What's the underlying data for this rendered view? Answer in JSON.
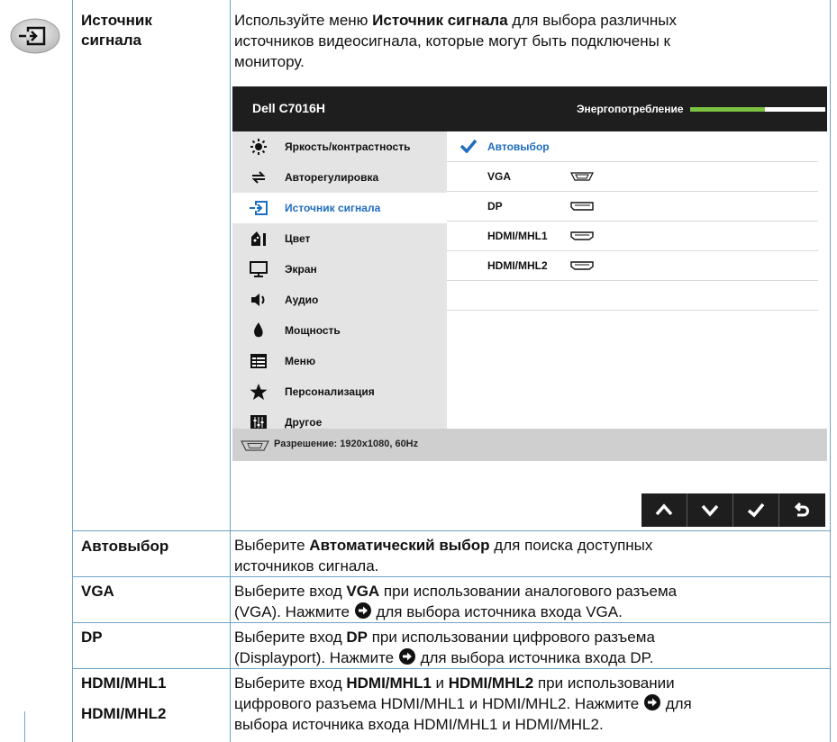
{
  "header_row": {
    "term_line1": "Источник",
    "term_line2": "сигнала",
    "desc_line1_pre": "Используйте меню ",
    "desc_line1_bold": "Источник сигнала",
    "desc_line1_post": " для выбора различных",
    "desc_line2": "источников видеосигнала, которые могут быть подключены к",
    "desc_line3": "монитору."
  },
  "osd": {
    "model": "Dell C7016H",
    "energy_label": "Энергопотребление",
    "energy_level": 0.55,
    "menu": [
      {
        "label": "Яркость/контрастность",
        "icon": "brightness-icon"
      },
      {
        "label": "Авторегулировка",
        "icon": "auto-adjust-icon"
      },
      {
        "label": "Источник сигнала",
        "icon": "input-source-icon"
      },
      {
        "label": "Цвет",
        "icon": "color-icon"
      },
      {
        "label": "Экран",
        "icon": "display-icon"
      },
      {
        "label": "Аудио",
        "icon": "audio-icon"
      },
      {
        "label": "Мощность",
        "icon": "power-icon"
      },
      {
        "label": "Меню",
        "icon": "menu-icon"
      },
      {
        "label": "Персонализация",
        "icon": "star-icon"
      },
      {
        "label": "Другое",
        "icon": "other-icon"
      }
    ],
    "active_menu": "Источник сигнала",
    "options": [
      {
        "label": "Автовыбор",
        "selected": true,
        "port": ""
      },
      {
        "label": "VGA",
        "selected": false,
        "port": "vga-port-icon"
      },
      {
        "label": "DP",
        "selected": false,
        "port": "dp-port-icon"
      },
      {
        "label": "HDMI/MHL1",
        "selected": false,
        "port": "hdmi-port-icon"
      },
      {
        "label": "HDMI/MHL2",
        "selected": false,
        "port": "hdmi-port-icon"
      }
    ],
    "footer_text": "Разрешение: 1920x1080, 60Hz",
    "buttons": [
      "up-arrow-icon",
      "down-arrow-icon",
      "check-icon",
      "back-icon"
    ],
    "accent": "#1f6dbf",
    "energy_color": "#7dc142"
  },
  "rows": {
    "auto": {
      "term": "Автовыбор",
      "l1_pre": "Выберите ",
      "l1_bold": "Автоматический выбор",
      "l1_post": " для поиска доступных",
      "l2": "источников сигнала."
    },
    "vga": {
      "term": "VGA",
      "l1_pre": "Выберите вход ",
      "l1_bold": "VGA",
      "l1_post": " при использовании аналогового разъема",
      "l2_pre": "(VGA). Нажмите ",
      "l2_post": " для выбора источника входа VGA."
    },
    "dp": {
      "term": "DP",
      "l1_pre": "Выберите вход ",
      "l1_bold": "DP",
      "l1_post": " при использовании цифрового разъема",
      "l2_pre": "(Displayport). Нажмите ",
      "l2_post": " для выбора источника входа DP."
    },
    "hdmi": {
      "term1": "HDMI/MHL1",
      "term2": "HDMI/MHL2",
      "l1_pre": "Выберите вход ",
      "l1_bold1": "HDMI/MHL1",
      "l1_mid": " и ",
      "l1_bold2": "HDMI/MHL2",
      "l1_post": " при использовании",
      "l2_pre": "цифрового разъема HDMI/MHL1 и HDMI/MHL2. Нажмите ",
      "l2_post": " для",
      "l3": "выбора источника входа HDMI/MHL1 и HDMI/MHL2."
    }
  }
}
